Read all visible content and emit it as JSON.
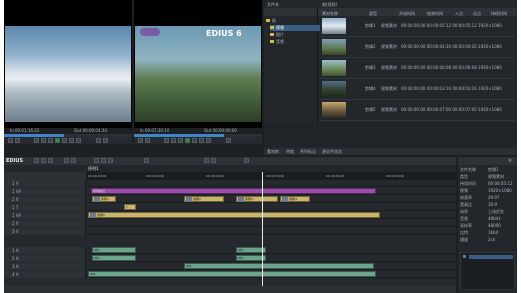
{
  "app": {
    "logo_text": "EDIUS 6",
    "tl_title": "EDIUS"
  },
  "player": {
    "in_tc": "In 00:01:16:22",
    "out_tc": "Out 00:00:04:24"
  },
  "recorder": {
    "in_tc": "In 00:07:20:10",
    "out_tc": "Out 00:00:00:00"
  },
  "bin": {
    "folder_header": "文件夹",
    "folders": [
      "根",
      "视频",
      "图片",
      "音频"
    ],
    "tab_label": "根(视频)",
    "columns": [
      "素材名称",
      "类型",
      "开始时间",
      "结束时间",
      "入点",
      "出点",
      "持续时间"
    ],
    "rows": [
      {
        "name": "剪辑1",
        "type": "视频素材",
        "tc": "00:00:00:00  00:00:05:12  00:00:05:12  1920×1080"
      },
      {
        "name": "剪辑2",
        "type": "视频素材",
        "tc": "00:00:00:00  00:00:04:20  00:00:04:20  1920×1080"
      },
      {
        "name": "剪辑3",
        "type": "视频素材",
        "tc": "00:00:00:00  00:00:06:08  00:00:06:08  1920×1080"
      },
      {
        "name": "剪辑4",
        "type": "视频素材",
        "tc": "00:00:00:00  00:00:03:16  00:00:03:16  1920×1080"
      },
      {
        "name": "剪辑5",
        "type": "视频素材",
        "tc": "00:00:00:00  00:00:07:00  00:00:07:00  1920×1080"
      }
    ],
    "bottom_tabs": [
      "素材库",
      "特效",
      "序列标记",
      "源文件浏览"
    ]
  },
  "timeline": {
    "tab": "序列1",
    "ruler": [
      "00:00:00;00",
      "00:00:10;00",
      "00:00:20;00",
      "00:00:30;00",
      "00:00:40;00",
      "00:00:50;00"
    ],
    "tracks": [
      {
        "name": "1 V",
        "clips": []
      },
      {
        "name": "1 VA",
        "clips": [
          {
            "label": "序列标记",
            "type": "m"
          }
        ]
      },
      {
        "name": "2 V",
        "clips": [
          {
            "label": "剪辑1",
            "type": "v"
          },
          {
            "label": "剪辑2",
            "type": "v"
          },
          {
            "label": "剪辑3",
            "type": "v"
          },
          {
            "label": "剪辑4",
            "type": "v"
          }
        ]
      },
      {
        "name": "1 T",
        "clips": [
          {
            "label": "T",
            "type": "v"
          }
        ]
      },
      {
        "name": "1 VA",
        "clips": [
          {
            "label": "剪辑5",
            "type": "v"
          }
        ]
      },
      {
        "name": "2 V",
        "clips": []
      },
      {
        "name": "3 V",
        "clips": []
      },
      {
        "name": "1 A",
        "clips": [
          {
            "label": "001",
            "type": "a"
          },
          {
            "label": "001",
            "type": "a"
          }
        ]
      },
      {
        "name": "2 A",
        "clips": [
          {
            "label": "001",
            "type": "a"
          },
          {
            "label": "001",
            "type": "a"
          }
        ]
      },
      {
        "name": "3 A",
        "clips": [
          {
            "label": "001",
            "type": "a"
          }
        ]
      },
      {
        "name": "4 A",
        "clips": [
          {
            "label": "001",
            "type": "a"
          }
        ]
      }
    ]
  },
  "props": {
    "labels": [
      "文件名称",
      "类型",
      "持续时间",
      "视频",
      "帧速率",
      "宽高比",
      "场序",
      "音频",
      "采样率",
      "比特",
      "通道"
    ],
    "values": [
      "剪辑1",
      "视频素材",
      "00:00:05:12",
      "1920×1080",
      "29.97",
      "16:9",
      "上场优先",
      "48kHz",
      "48000",
      "16bit",
      "2ch"
    ]
  },
  "colors": {
    "video_clip": "#c9b56a",
    "audio_clip": "#6aa48c",
    "marker_clip": "#9b4fa8",
    "playhead": "#e9e9e9"
  }
}
